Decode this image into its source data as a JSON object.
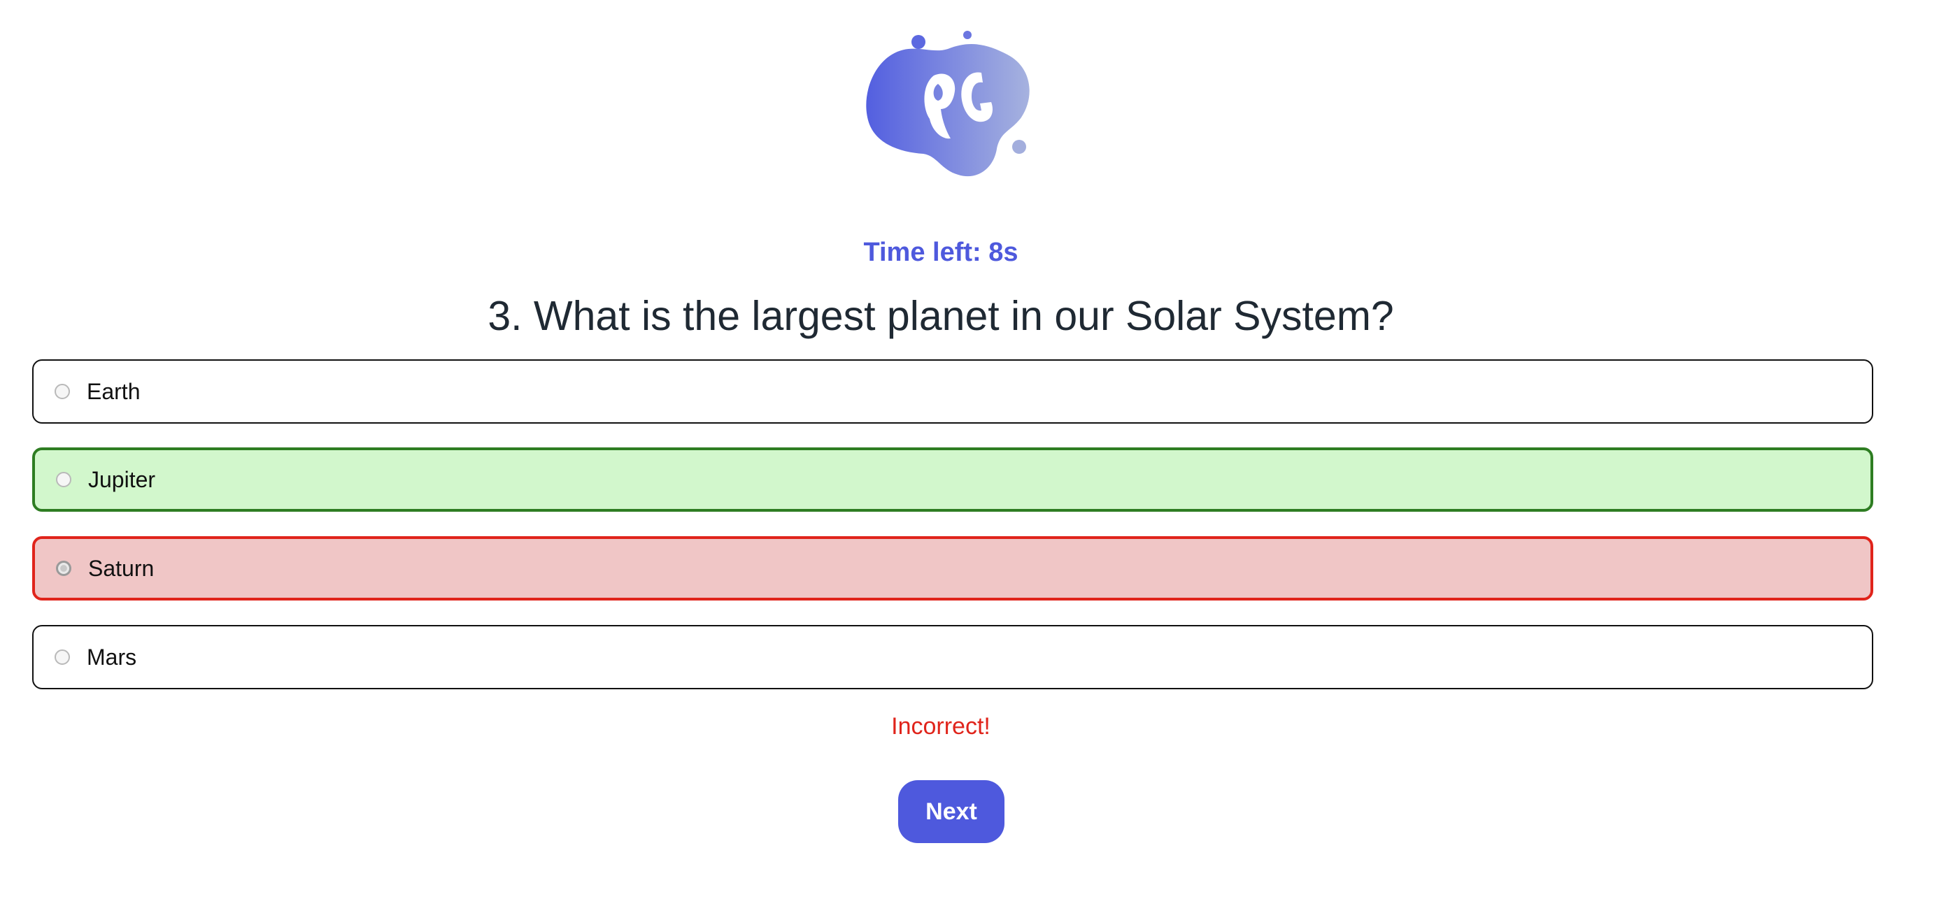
{
  "logo": {
    "icon": "quiz-game-logo-icon",
    "letters": "QG"
  },
  "timer": {
    "text": "Time left: 8s"
  },
  "question": {
    "text": "3. What is the largest planet in our Solar System?"
  },
  "options": [
    {
      "label": "Earth",
      "state": "default"
    },
    {
      "label": "Jupiter",
      "state": "correct"
    },
    {
      "label": "Saturn",
      "state": "incorrect-selected"
    },
    {
      "label": "Mars",
      "state": "default"
    }
  ],
  "feedback": {
    "text": "Incorrect!"
  },
  "next_button": {
    "label": "Next"
  },
  "colors": {
    "accent": "#4e59dd",
    "correct_bg": "#d2f7cc",
    "correct_border": "#2e7d22",
    "incorrect_bg": "#f0c6c6",
    "incorrect_border": "#e0241b"
  }
}
